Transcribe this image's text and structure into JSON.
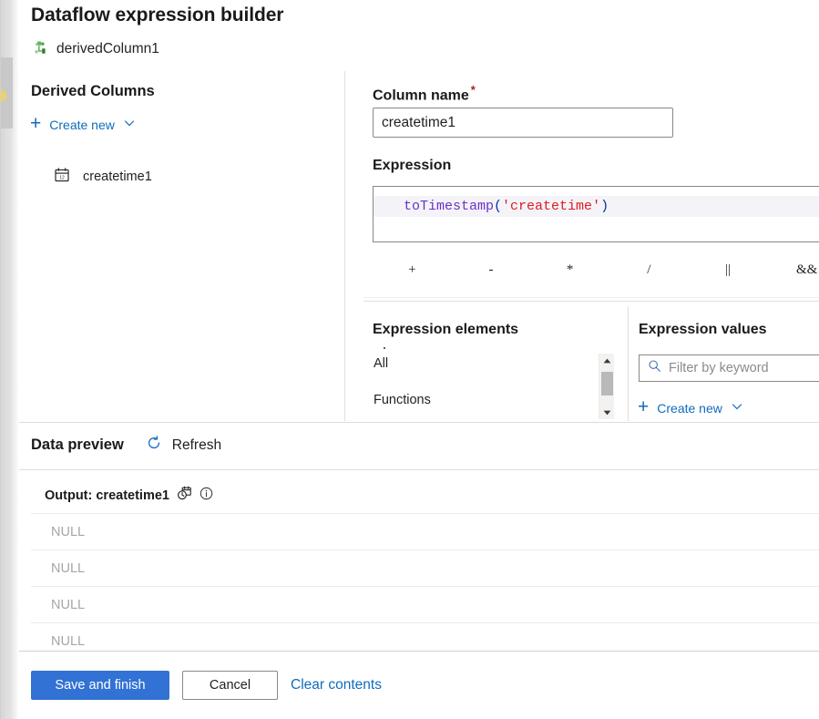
{
  "header": {
    "title": "Dataflow expression builder",
    "subtitle": "derivedColumn1",
    "subtitle_icon": "derived-column-icon"
  },
  "left_panel": {
    "section_title": "Derived Columns",
    "create_new_label": "Create new",
    "create_new_icon": "plus-icon",
    "create_new_chevron": "chevron-down-icon",
    "columns": [
      {
        "label": "createtime1",
        "icon": "calendar-icon"
      }
    ]
  },
  "right_panel": {
    "column_name": {
      "label": "Column name",
      "required_marker": "*",
      "value": "createtime1",
      "placeholder": ""
    },
    "expression": {
      "label": "Expression",
      "text": "toTimestamp('createtime')",
      "tokens": [
        {
          "text": "toTimestamp",
          "kind": "function"
        },
        {
          "text": "(",
          "kind": "paren"
        },
        {
          "text": "'createtime'",
          "kind": "string"
        },
        {
          "text": ")",
          "kind": "paren"
        }
      ]
    },
    "operators": [
      "+",
      "-",
      "*",
      "/",
      "||",
      "&&"
    ]
  },
  "expression_elements": {
    "title": "Expression elements",
    "items": [
      "All",
      "Functions"
    ],
    "scrollbar": {
      "up_icon": "caret-up-icon",
      "down_icon": "caret-down-icon"
    }
  },
  "expression_values": {
    "title": "Expression values",
    "filter_placeholder": "Filter by keyword",
    "filter_value": "",
    "search_icon": "search-icon",
    "create_new_label": "Create new",
    "create_new_icon": "plus-icon",
    "create_new_chevron": "chevron-down-icon"
  },
  "data_preview": {
    "title": "Data preview",
    "refresh_label": "Refresh",
    "refresh_icon": "refresh-icon",
    "column_header": "Output: createtime1",
    "column_type_icon": "timestamp-icon",
    "info_icon": "info-icon",
    "rows": [
      "NULL",
      "NULL",
      "NULL",
      "NULL"
    ]
  },
  "footer": {
    "save_label": "Save and finish",
    "cancel_label": "Cancel",
    "clear_label": "Clear contents"
  },
  "colors": {
    "accent": "#0f6cbd",
    "primary_button": "#3272d4",
    "required": "#a4262c",
    "token_function": "#6b32c9",
    "token_paren": "#0b2ea8",
    "token_string": "#e01b24",
    "null_text": "#a6a6a6"
  }
}
